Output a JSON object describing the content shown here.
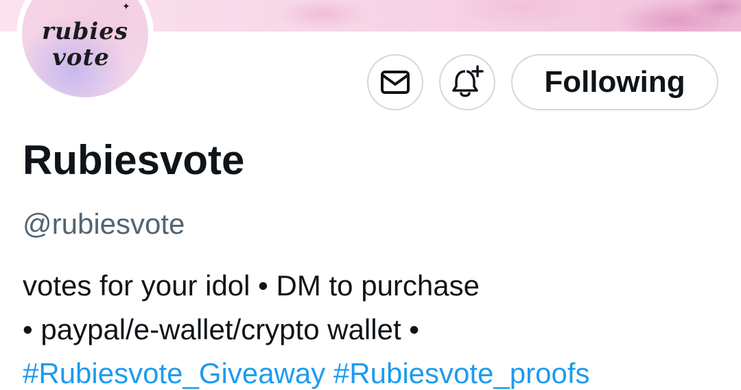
{
  "avatar": {
    "line1": "rubies",
    "line2": "vote"
  },
  "actions": {
    "message_icon": "envelope-icon",
    "notify_icon": "bell-plus-icon",
    "follow_label": "Following"
  },
  "profile": {
    "display_name": "Rubiesvote",
    "handle": "@rubiesvote",
    "bio_line1": "votes for your idol • DM to purchase",
    "bio_line2": "• paypal/e-wallet/crypto wallet •",
    "hashtags": [
      "#Rubiesvote_Giveaway",
      "#Rubiesvote_proofs"
    ]
  },
  "colors": {
    "text_primary": "#0f1419",
    "text_secondary": "#536471",
    "link": "#1d9bf0",
    "button_border": "#cfd9de"
  }
}
